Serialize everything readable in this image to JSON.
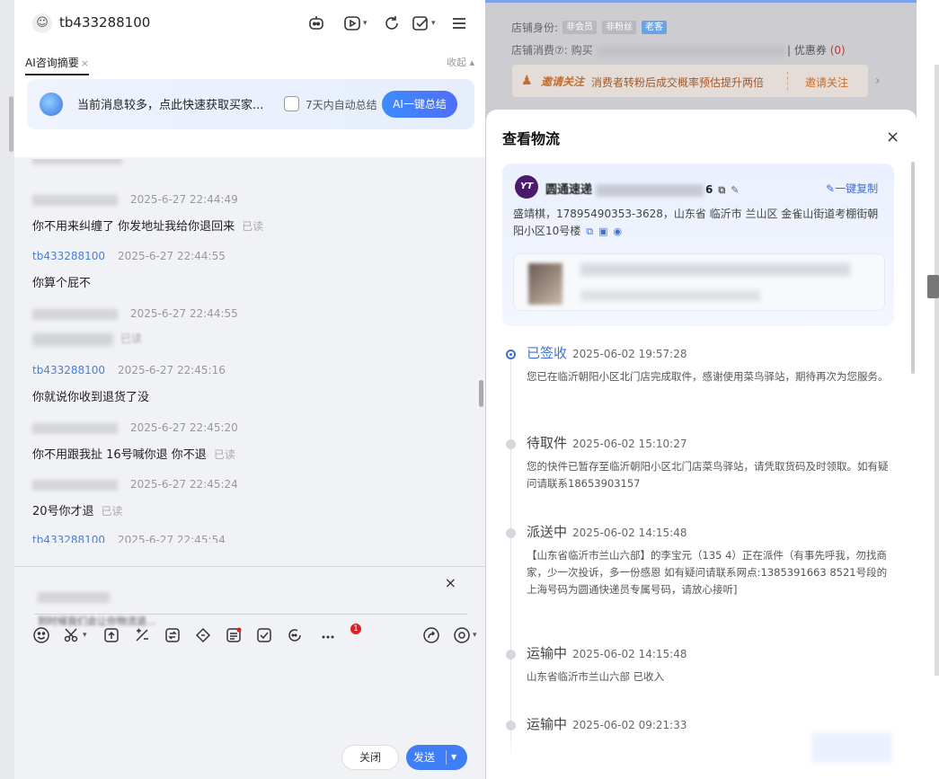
{
  "chat": {
    "username": "tb433288100",
    "ai_tab_label": "AI咨询摘要",
    "ai_tab_close": "×",
    "collapse_label": "收起 ▴",
    "banner_text": "当前消息较多，点此快速获取买家...",
    "auto_summary_label": "7天内自动总结",
    "ai_button_label": "AI一键总结",
    "messages": [
      {
        "sender": "",
        "time": "2025-6-27 22:44:49",
        "text": "你不用来纠缠了 你发地址我给你退回来",
        "read": "已读"
      },
      {
        "sender": "tb433288100",
        "time": "2025-6-27 22:44:55",
        "text": "你算个屁不",
        "read": ""
      },
      {
        "sender": "",
        "time": "2025-6-27 22:44:55",
        "text": "",
        "read": "已读"
      },
      {
        "sender": "tb433288100",
        "time": "2025-6-27 22:45:16",
        "text": "你就说你收到退货了没",
        "read": ""
      },
      {
        "sender": "",
        "time": "2025-6-27 22:45:20",
        "text": "你不用跟我扯  16号喊你退 你不退",
        "read": "已读"
      },
      {
        "sender": "",
        "time": "2025-6-27 22:45:24",
        "text": "20号你才退",
        "read": "已读"
      },
      {
        "sender": "tb433288100",
        "time": "2025-6-27 22:45:54",
        "text": "",
        "read": ""
      }
    ],
    "quote_text": "到时候我们会让你物流退...",
    "quote_close": "×",
    "badge_count": "1",
    "close_button": "关闭",
    "send_button": "发送"
  },
  "shop": {
    "identity_label": "店铺身份:",
    "tags": [
      "非会员",
      "非粉丝",
      "老客"
    ],
    "consumption_label": "店铺消费⑦: 购买",
    "coupon_label": "优惠券",
    "coupon_count": "(0)",
    "invite_title": "邀请关注",
    "invite_desc": "消费者转粉后成交概率预估提升两倍",
    "invite_button": "邀请关注",
    "colors": {
      "tag_gray": "#b7b9bf",
      "tag_blue": "#6aa2e6",
      "invite_bg": "#e4dcd6",
      "invite_text": "#c96b2a"
    }
  },
  "logistics": {
    "title": "查看物流",
    "close": "×",
    "carrier_logo": "YT",
    "carrier_name": "圆通速递",
    "tracking_tail": "6",
    "copy_all": "一键复制",
    "address": "盛靖棋，17895490353-3628，山东省 临沂市 兰山区 金雀山街道考棚街朝阳小区10号楼",
    "events": [
      {
        "status": "已签收",
        "time": "2025-06-02 19:57:28",
        "desc": "您已在临沂朝阳小区北门店完成取件，感谢使用菜鸟驿站，期待再次为您服务。",
        "active": true
      },
      {
        "status": "待取件",
        "time": "2025-06-02 15:10:27",
        "desc": "您的快件已暂存至临沂朝阳小区北门店菜鸟驿站，请凭取货码及时领取。如有疑问请联系18653903157"
      },
      {
        "status": "派送中",
        "time": "2025-06-02 14:15:48",
        "desc": "【山东省临沂市兰山六部】的李宝元（135      4）正在派件（有事先呼我，勿找商家，少一次投诉，多一份感恩      如有疑问请联系网点:1385391663      8521号段的上海号码为圆通快递员专属号码，请放心接听]"
      },
      {
        "status": "运输中",
        "time": "2025-06-02 14:15:48",
        "desc": "山东省临沂市兰山六部 已收入"
      },
      {
        "status": "运输中",
        "time": "2025-06-02 09:21:33",
        "desc": ""
      }
    ]
  }
}
